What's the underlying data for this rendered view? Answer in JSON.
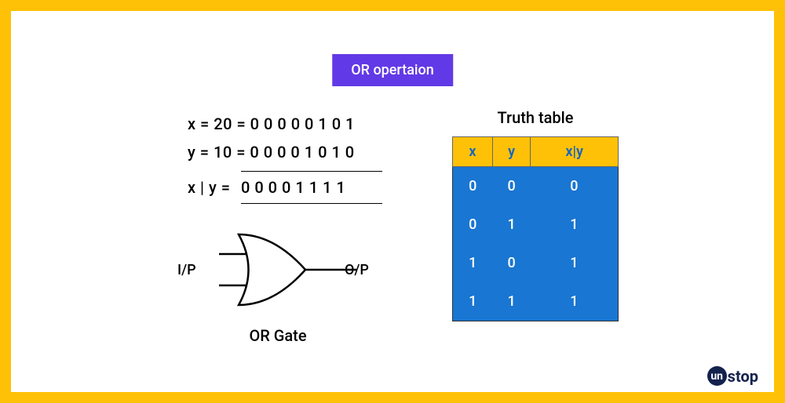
{
  "title": "OR opertaion",
  "equations": {
    "line1": "x = 20 = 0 0 0 0 0 1 0 1",
    "line2": "y = 10 = 0 0 0 0 1 0 1 0",
    "result_label": "x | y  =",
    "result_value": "0 0 0 0 1 1 1 1"
  },
  "gate": {
    "input_label": "I/P",
    "output_label": "O/P",
    "caption": "OR Gate"
  },
  "truth_table": {
    "title": "Truth table",
    "headers": [
      "x",
      "y",
      "x|y"
    ],
    "rows": [
      [
        "0",
        "0",
        "0"
      ],
      [
        "0",
        "1",
        "1"
      ],
      [
        "1",
        "0",
        "1"
      ],
      [
        "1",
        "1",
        "1"
      ]
    ]
  },
  "logo": {
    "prefix": "un",
    "suffix": "stop"
  }
}
